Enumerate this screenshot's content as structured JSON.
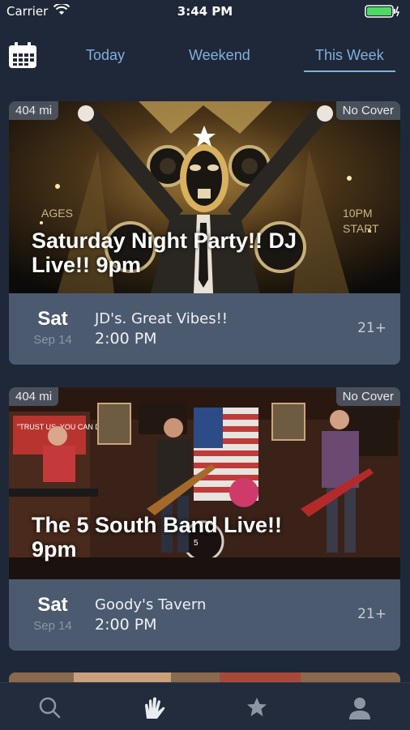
{
  "status": {
    "carrier": "Carrier",
    "time": "3:44 PM"
  },
  "tabs": [
    "Today",
    "Weekend",
    "This Week"
  ],
  "events": [
    {
      "distance": "404 mi",
      "cover": "No Cover",
      "title_line1": "Saturday Night Party!!  DJ",
      "title_line2": "Live!!  9pm",
      "day": "Sat",
      "date": "Sep 14",
      "venue": "JD's.  Great Vibes!!",
      "time": "2:00 PM",
      "age": "21+",
      "poster_text_left": "AGES",
      "poster_text_right_1": "10PM",
      "poster_text_right_2": "START"
    },
    {
      "distance": "404 mi",
      "cover": "No Cover",
      "title_line1": "The 5 South Band Live!!",
      "title_line2": "9pm",
      "day": "Sat",
      "date": "Sep 14",
      "venue": "Goody's Tavern",
      "time": "2:00 PM",
      "age": "21+",
      "poster_text_sign": "\"TRUST US, YOU CAN DANCE.\""
    }
  ],
  "tabbar": [
    "search-icon",
    "events-hand-icon",
    "favorites-star-icon",
    "profile-icon"
  ],
  "colors": {
    "accent": "#7fb0de",
    "background": "#1f2838",
    "card": "#4c5a6f"
  }
}
